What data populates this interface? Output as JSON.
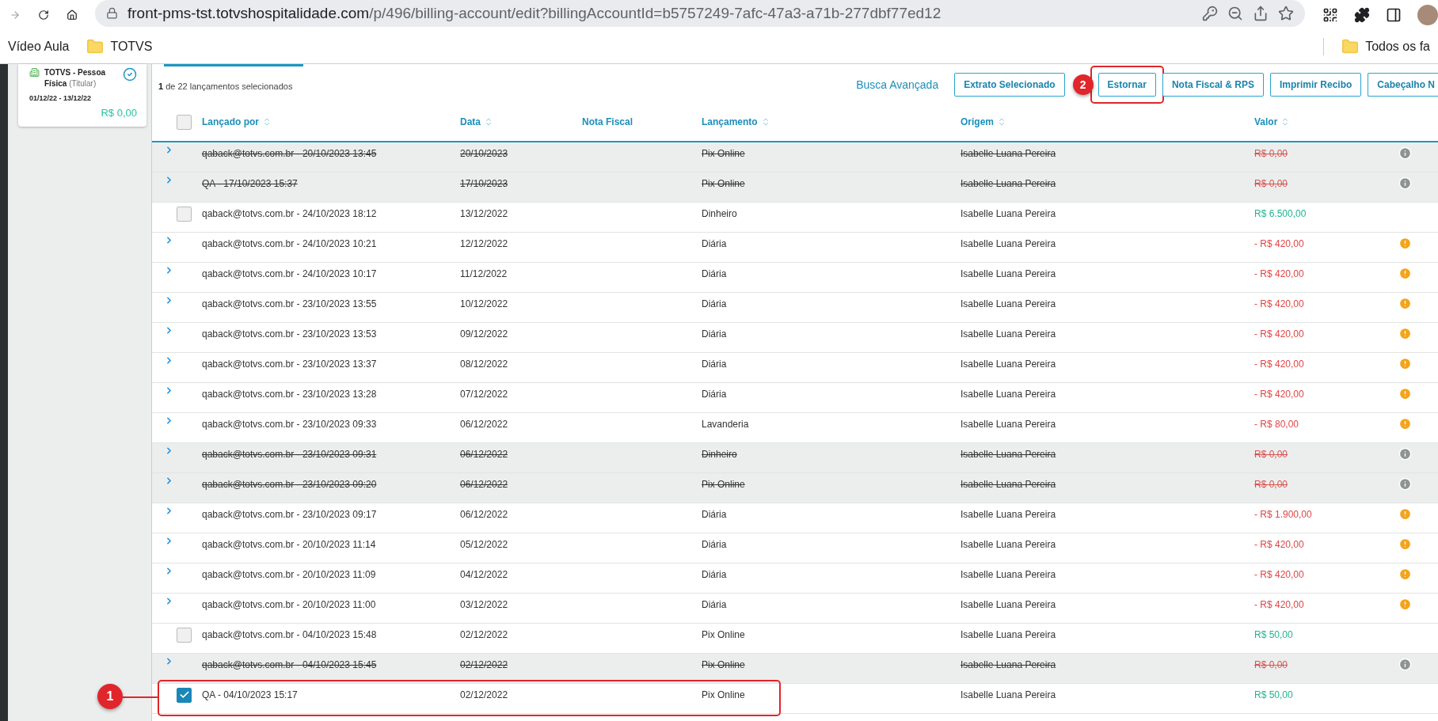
{
  "browser": {
    "url_host": "front-pms-tst.totvshospitalidade.com",
    "url_path": "/p/496/billing-account/edit?billingAccountId=b5757249-7afc-47a3-a71b-277dbf77ed12",
    "bookmarks": [
      {
        "label": "Vídeo Aula",
        "kind": "link"
      },
      {
        "label": "TOTVS",
        "kind": "folder"
      }
    ],
    "other_bookmarks": "Todos os fa"
  },
  "account_card": {
    "title": "**TOTVS - Pessoa Física** (Titular)",
    "period": "01/12/22 - 13/12/22",
    "balance": "R$ 0,00",
    "checked": true
  },
  "selection_summary": "**1** de 22 lançamentos selecionados",
  "advanced_search": "Busca Avançada",
  "actions": [
    "Extrato Selecionado",
    "Estornar",
    "Nota Fiscal & RPS",
    "Imprimir Recibo",
    "Cabeçalho N"
  ],
  "table": {
    "select_all_checked": false,
    "columns": [
      {
        "label": "Lançado por",
        "sortable": true
      },
      {
        "label": "Data",
        "sortable": true
      },
      {
        "label": "Nota Fiscal",
        "sortable": false
      },
      {
        "label": "Lançamento",
        "sortable": true
      },
      {
        "label": "Origem",
        "sortable": true
      },
      {
        "label": "Valor",
        "sortable": true
      }
    ],
    "rows": [
      {
        "kind": "reversed",
        "by": "qaback@totvs.com.br - 20/10/2023 13:45",
        "date": "20/10/2023",
        "entry": "Pix Online",
        "origin": "Isabelle Luana Pereira",
        "value": "R$ 0,00"
      },
      {
        "kind": "reversed",
        "by": "QA - 17/10/2023 15:37",
        "date": "17/10/2023",
        "entry": "Pix Online",
        "origin": "Isabelle Luana Pereira",
        "value": "R$ 0,00"
      },
      {
        "kind": "credit",
        "checked": false,
        "by": "qaback@totvs.com.br - 24/10/2023 18:12",
        "date": "13/12/2022",
        "entry": "Dinheiro",
        "origin": "Isabelle Luana Pereira",
        "value": "R$ 6.500,00"
      },
      {
        "kind": "debit",
        "by": "qaback@totvs.com.br - 24/10/2023 10:21",
        "date": "12/12/2022",
        "entry": "Diária",
        "origin": "Isabelle Luana Pereira",
        "value": "- R$ 420,00"
      },
      {
        "kind": "debit",
        "by": "qaback@totvs.com.br - 24/10/2023 10:17",
        "date": "11/12/2022",
        "entry": "Diária",
        "origin": "Isabelle Luana Pereira",
        "value": "- R$ 420,00"
      },
      {
        "kind": "debit",
        "by": "qaback@totvs.com.br - 23/10/2023 13:55",
        "date": "10/12/2022",
        "entry": "Diária",
        "origin": "Isabelle Luana Pereira",
        "value": "- R$ 420,00"
      },
      {
        "kind": "debit",
        "by": "qaback@totvs.com.br - 23/10/2023 13:53",
        "date": "09/12/2022",
        "entry": "Diária",
        "origin": "Isabelle Luana Pereira",
        "value": "- R$ 420,00"
      },
      {
        "kind": "debit",
        "by": "qaback@totvs.com.br - 23/10/2023 13:37",
        "date": "08/12/2022",
        "entry": "Diária",
        "origin": "Isabelle Luana Pereira",
        "value": "- R$ 420,00"
      },
      {
        "kind": "debit",
        "by": "qaback@totvs.com.br - 23/10/2023 13:28",
        "date": "07/12/2022",
        "entry": "Diária",
        "origin": "Isabelle Luana Pereira",
        "value": "- R$ 420,00"
      },
      {
        "kind": "debit",
        "by": "qaback@totvs.com.br - 23/10/2023 09:33",
        "date": "06/12/2022",
        "entry": "Lavanderia",
        "origin": "Isabelle Luana Pereira",
        "value": "- R$ 80,00"
      },
      {
        "kind": "reversed",
        "by": "qaback@totvs.com.br - 23/10/2023 09:31",
        "date": "06/12/2022",
        "entry": "Dinheiro",
        "origin": "Isabelle Luana Pereira",
        "value": "R$ 0,00"
      },
      {
        "kind": "reversed",
        "by": "qaback@totvs.com.br - 23/10/2023 09:20",
        "date": "06/12/2022",
        "entry": "Pix Online",
        "origin": "Isabelle Luana Pereira",
        "value": "R$ 0,00"
      },
      {
        "kind": "debit",
        "by": "qaback@totvs.com.br - 23/10/2023 09:17",
        "date": "06/12/2022",
        "entry": "Diária",
        "origin": "Isabelle Luana Pereira",
        "value": "- R$ 1.900,00"
      },
      {
        "kind": "debit",
        "by": "qaback@totvs.com.br - 20/10/2023 11:14",
        "date": "05/12/2022",
        "entry": "Diária",
        "origin": "Isabelle Luana Pereira",
        "value": "- R$ 420,00"
      },
      {
        "kind": "debit",
        "by": "qaback@totvs.com.br - 20/10/2023 11:09",
        "date": "04/12/2022",
        "entry": "Diária",
        "origin": "Isabelle Luana Pereira",
        "value": "- R$ 420,00"
      },
      {
        "kind": "debit",
        "by": "qaback@totvs.com.br - 20/10/2023 11:00",
        "date": "03/12/2022",
        "entry": "Diária",
        "origin": "Isabelle Luana Pereira",
        "value": "- R$ 420,00"
      },
      {
        "kind": "credit",
        "checked": false,
        "by": "qaback@totvs.com.br - 04/10/2023 15:48",
        "date": "02/12/2022",
        "entry": "Pix Online",
        "origin": "Isabelle Luana Pereira",
        "value": "R$ 50,00"
      },
      {
        "kind": "reversed",
        "by": "qaback@totvs.com.br - 04/10/2023 15:45",
        "date": "02/12/2022",
        "entry": "Pix Online",
        "origin": "Isabelle Luana Pereira",
        "value": "R$ 0,00"
      },
      {
        "kind": "credit",
        "checked": true,
        "by": "QA - 04/10/2023 15:17",
        "date": "02/12/2022",
        "entry": "Pix Online",
        "origin": "Isabelle Luana Pereira",
        "value": "R$ 50,00"
      }
    ]
  },
  "annotations": [
    {
      "label": "1"
    },
    {
      "label": "2"
    }
  ]
}
